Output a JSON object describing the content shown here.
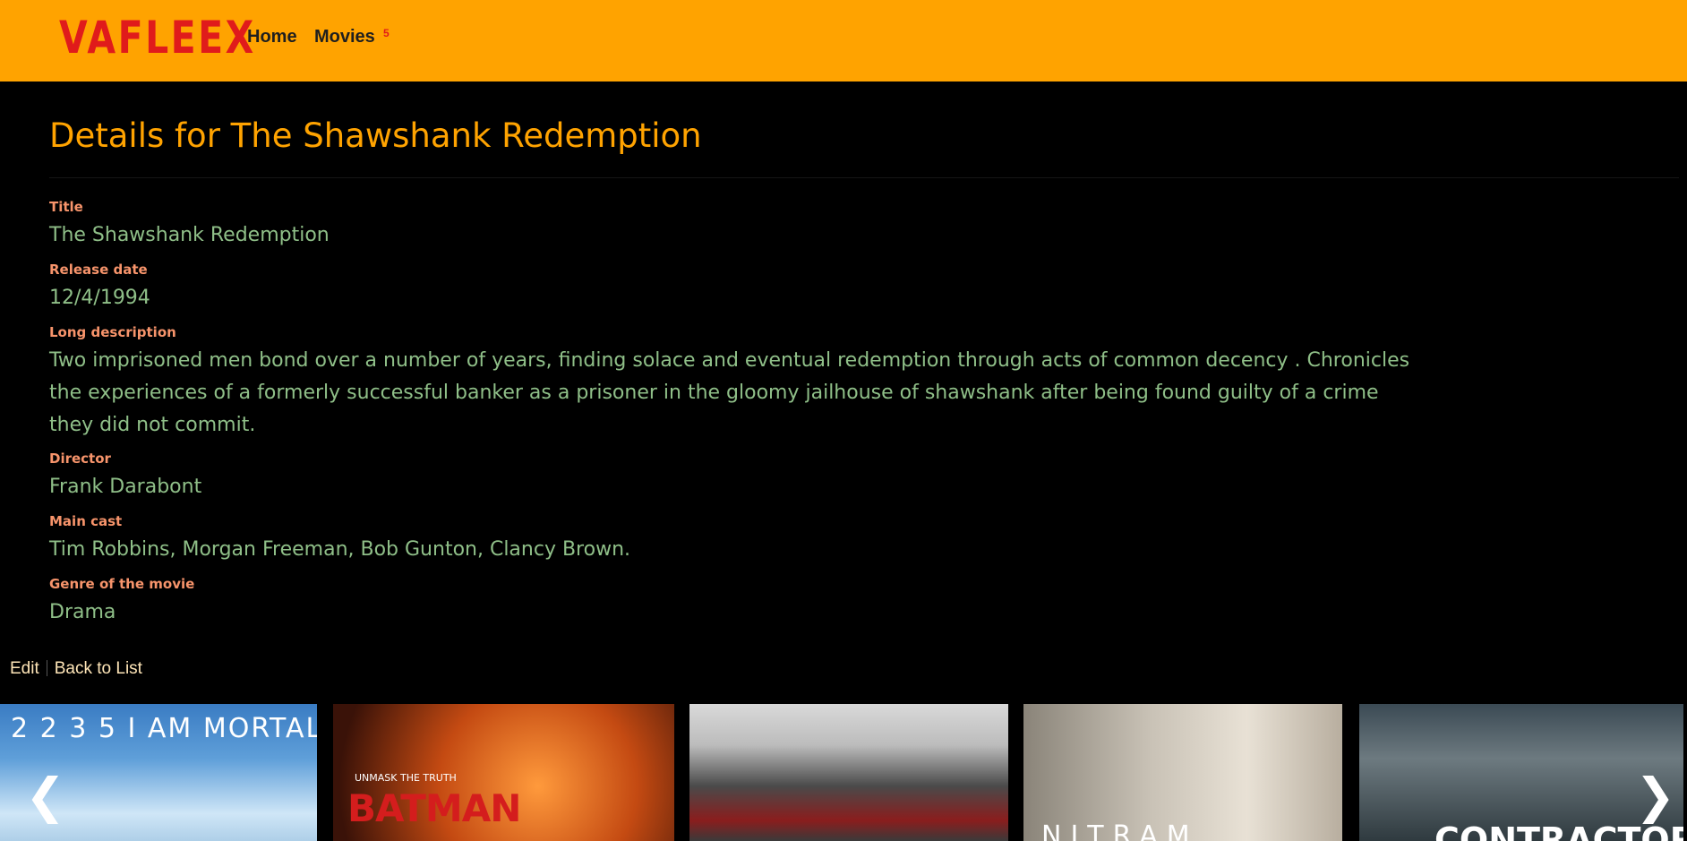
{
  "header": {
    "logo": "VAFLEEX",
    "nav": {
      "home": "Home",
      "movies": "Movies",
      "movies_badge": "5"
    },
    "colors": {
      "background": "#FFA300",
      "logo": "#E01B1B"
    }
  },
  "details": {
    "heading": "Details for The Shawshank Redemption",
    "fields": [
      {
        "label": "Title",
        "value": "The Shawshank Redemption"
      },
      {
        "label": "Release date",
        "value": "12/4/1994"
      },
      {
        "label": "Long description",
        "value": "Two imprisoned men bond over a number of years, finding solace and eventual redemption through acts of common decency . Chronicles the experiences of a formerly successful banker as a prisoner in the gloomy jailhouse of shawshank after being found guilty of a crime they did not commit."
      },
      {
        "label": "Director",
        "value": "Frank Darabont"
      },
      {
        "label": "Main cast",
        "value": "Tim Robbins, Morgan Freeman, Bob Gunton, Clancy Brown."
      },
      {
        "label": "Genre of the movie",
        "value": "Drama"
      }
    ],
    "colors": {
      "heading": "#FFA300",
      "label": "#F7946B",
      "value": "#8FBF88"
    }
  },
  "actions": {
    "edit": "Edit",
    "back": "Back to List"
  },
  "carousel": {
    "posters": [
      {
        "name": "poster-i-am-mortal",
        "title": "2 2 3 5  I AM MORTAL"
      },
      {
        "name": "poster-the-batman",
        "title": "BATMAN",
        "tagline": "UNMASK THE TRUTH"
      },
      {
        "name": "poster-group-photo"
      },
      {
        "name": "poster-nitram",
        "title": "NITRAM"
      },
      {
        "name": "poster-the-contractor",
        "title": "CONTRACTOR"
      }
    ],
    "prev_icon": "chevron-left-icon",
    "next_icon": "chevron-right-icon"
  }
}
